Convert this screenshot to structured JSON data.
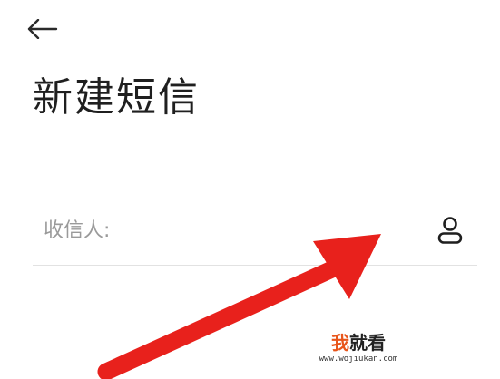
{
  "header": {
    "back_icon": "arrow-left-icon"
  },
  "page": {
    "title": "新建短信"
  },
  "recipient": {
    "placeholder": "收信人:",
    "value": "",
    "contact_icon": "person-icon"
  },
  "overlay": {
    "arrow_color": "#e8211c"
  },
  "watermark": {
    "accent": "我",
    "text": "就看",
    "url": "www.wojiukan.com"
  }
}
